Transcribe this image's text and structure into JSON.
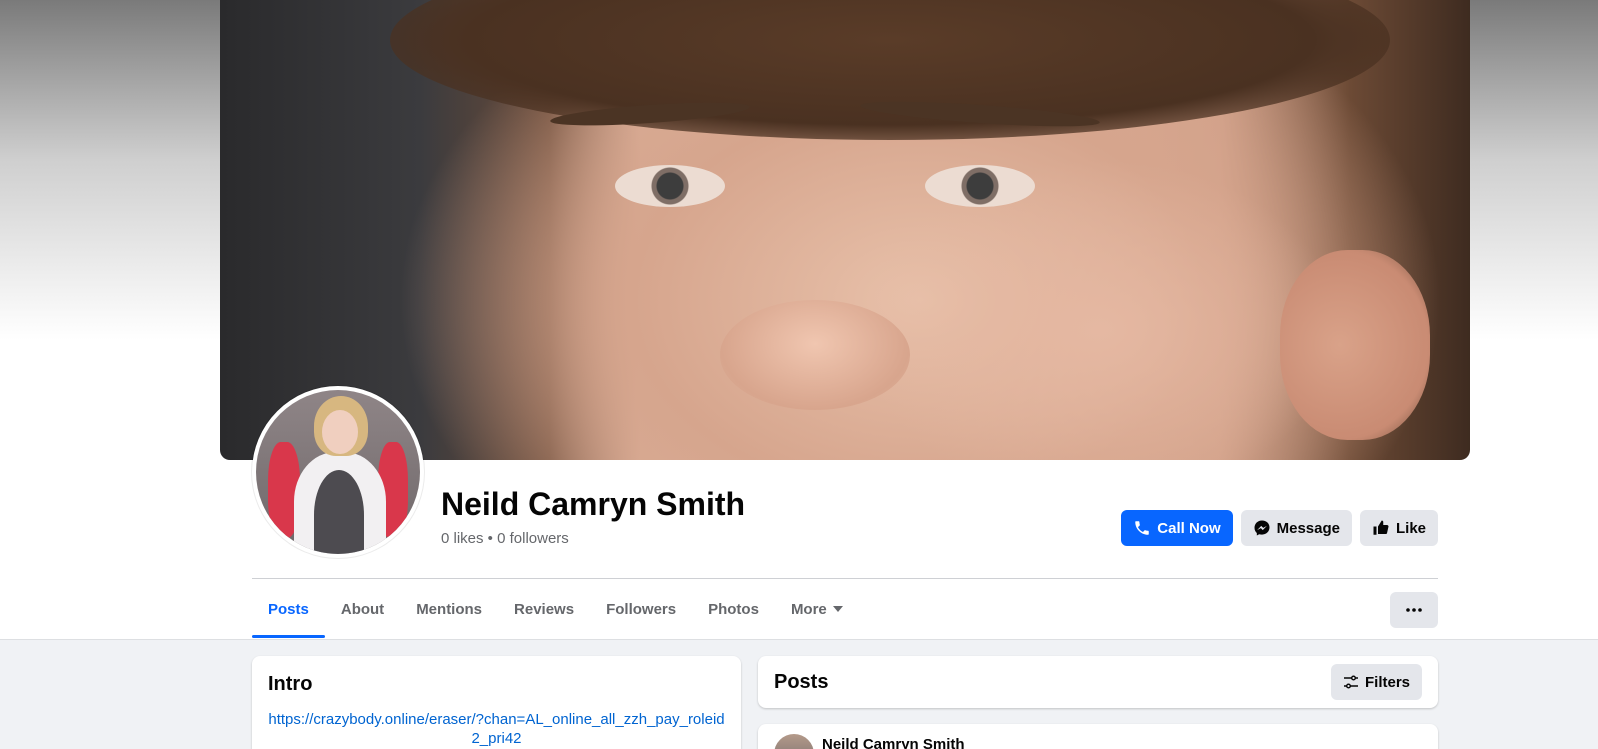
{
  "page": {
    "name": "Neild Camryn Smith",
    "stats": "0 likes • 0 followers"
  },
  "actions": {
    "call_now": "Call Now",
    "message": "Message",
    "like": "Like"
  },
  "tabs": [
    {
      "label": "Posts",
      "active": true
    },
    {
      "label": "About"
    },
    {
      "label": "Mentions"
    },
    {
      "label": "Reviews"
    },
    {
      "label": "Followers"
    },
    {
      "label": "Photos"
    },
    {
      "label": "More"
    }
  ],
  "intro": {
    "title": "Intro",
    "link": "https://crazybody.online/eraser/?chan=AL_online_all_zzh_pay_roleid2_pri42"
  },
  "posts": {
    "title": "Posts",
    "filters_label": "Filters",
    "first_post_author": "Neild Camryn Smith"
  },
  "colors": {
    "accent": "#0866ff",
    "link": "#0064d1",
    "button_gray": "#e4e6eb"
  }
}
